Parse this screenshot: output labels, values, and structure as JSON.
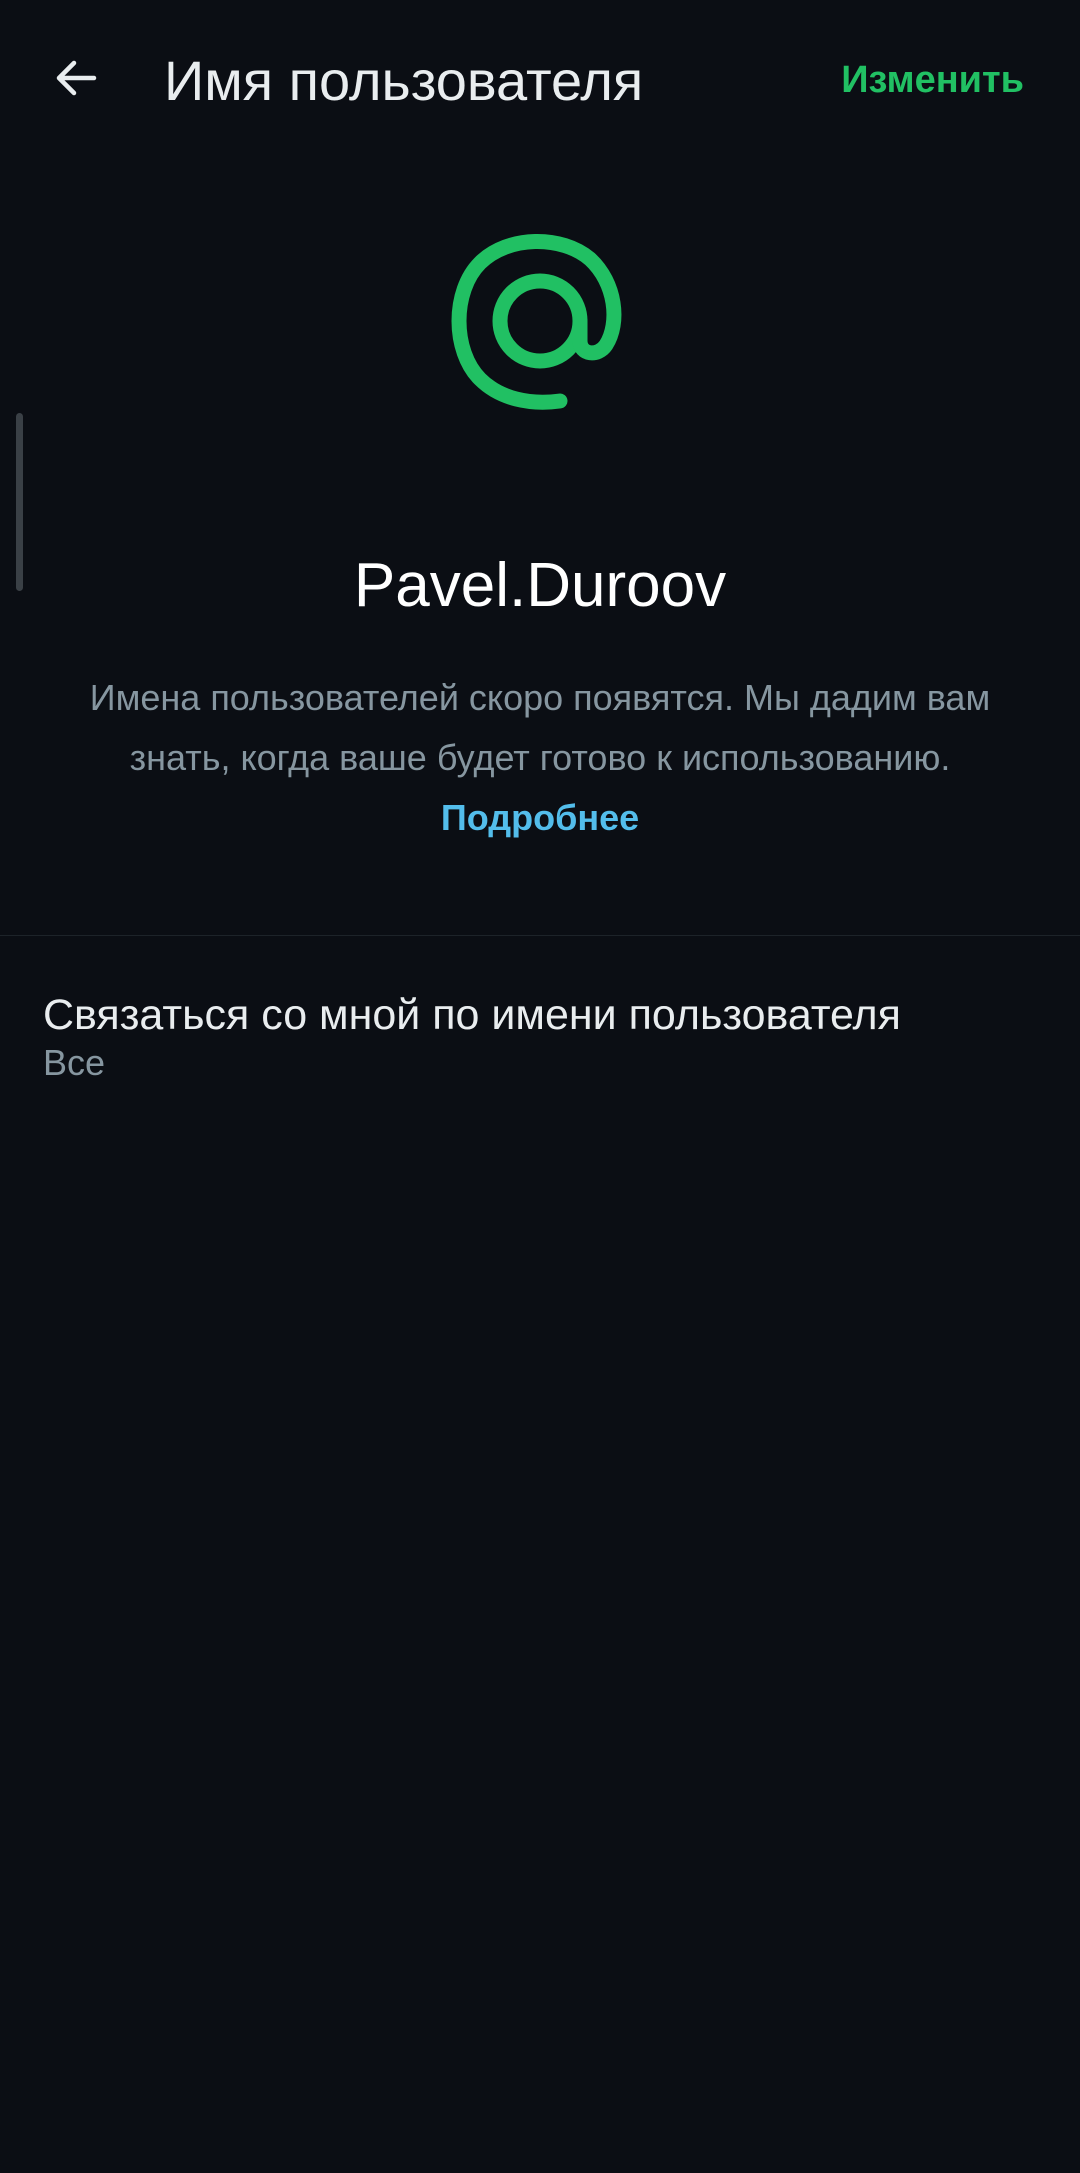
{
  "header": {
    "back_icon": "arrow-left-icon",
    "title": "Имя пользователя",
    "edit_label": "Изменить"
  },
  "hero": {
    "icon": "at-sign-icon",
    "username": "Pavel.Duroov"
  },
  "info": {
    "text": "Имена пользователей скоро появятся. Мы дадим вам знать, когда ваше будет готово к использованию.",
    "link_label": "Подробнее"
  },
  "settings": {
    "contact_by_username": {
      "title": "Связаться со мной по имени пользователя",
      "value": "Все"
    }
  },
  "colors": {
    "background": "#0b0e14",
    "accent_green": "#21c063",
    "link_blue": "#53bdeb",
    "secondary_text": "#8696a0"
  }
}
